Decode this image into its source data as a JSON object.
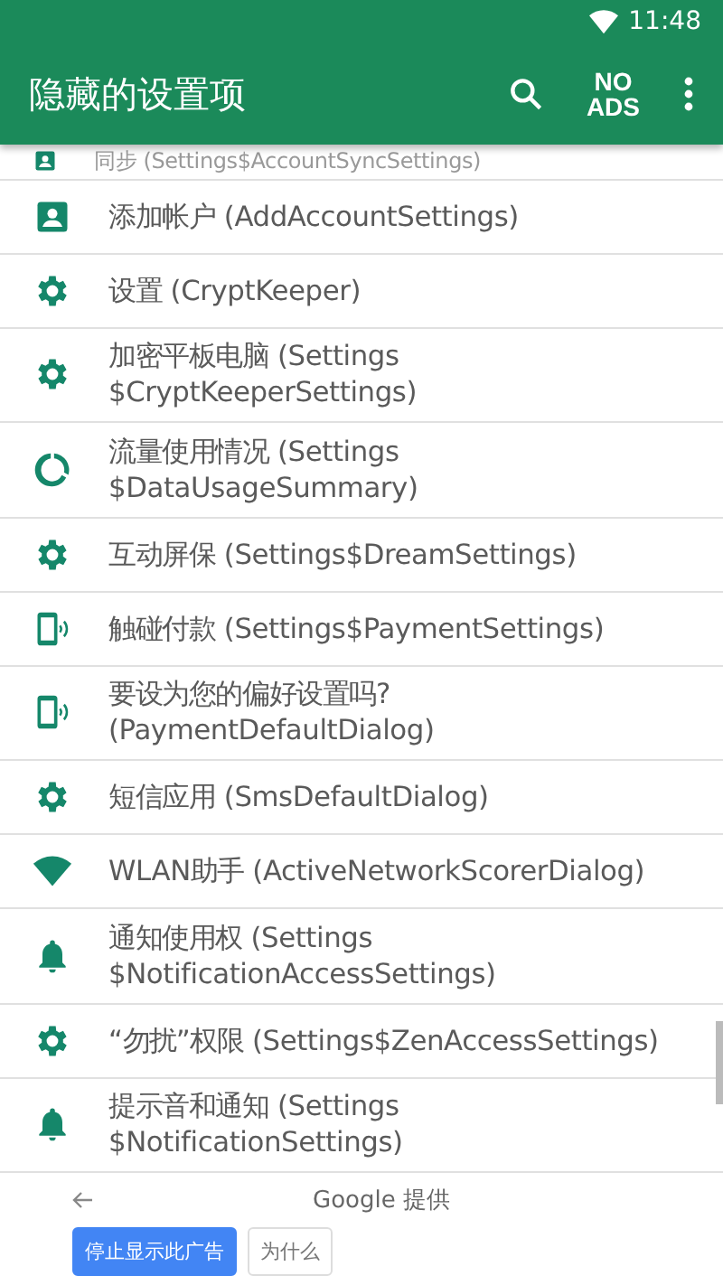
{
  "status_bar": {
    "time": "11:48"
  },
  "app_bar": {
    "title": "隐藏的设置项",
    "no_ads": [
      "NO",
      "ADS"
    ]
  },
  "items": [
    {
      "kind": "account",
      "label": "同步 (Settings$AccountSyncSettings)",
      "partial": true
    },
    {
      "kind": "account",
      "label": "添加帐户 (AddAccountSettings)",
      "partial": false
    },
    {
      "kind": "gear",
      "label": "设置 (CryptKeeper)",
      "partial": false
    },
    {
      "kind": "gear",
      "label": "加密平板电脑 (Settings\n$CryptKeeperSettings)",
      "partial": false
    },
    {
      "kind": "usage",
      "label": "流量使用情况 (Settings\n$DataUsageSummary)",
      "partial": false
    },
    {
      "kind": "gear",
      "label": "互动屏保 (Settings$DreamSettings)",
      "partial": false
    },
    {
      "kind": "phone",
      "label": "触碰付款 (Settings$PaymentSettings)",
      "partial": false
    },
    {
      "kind": "phone",
      "label": "要设为您的偏好设置吗?\n(PaymentDefaultDialog)",
      "partial": false
    },
    {
      "kind": "gear",
      "label": "短信应用 (SmsDefaultDialog)",
      "partial": false
    },
    {
      "kind": "wifi",
      "label": "WLAN助手 (ActiveNetworkScorerDialog)",
      "partial": false
    },
    {
      "kind": "bell",
      "label": "通知使用权 (Settings\n$NotificationAccessSettings)",
      "partial": false
    },
    {
      "kind": "gear",
      "label": "“勿扰”权限 (Settings$ZenAccessSettings)",
      "partial": false
    },
    {
      "kind": "bell",
      "label": "提示音和通知 (Settings\n$NotificationSettings)",
      "partial": false
    }
  ],
  "ad": {
    "provider": "Google 提供",
    "stop_button": "停止显示此广告",
    "why_button": "为什么"
  }
}
